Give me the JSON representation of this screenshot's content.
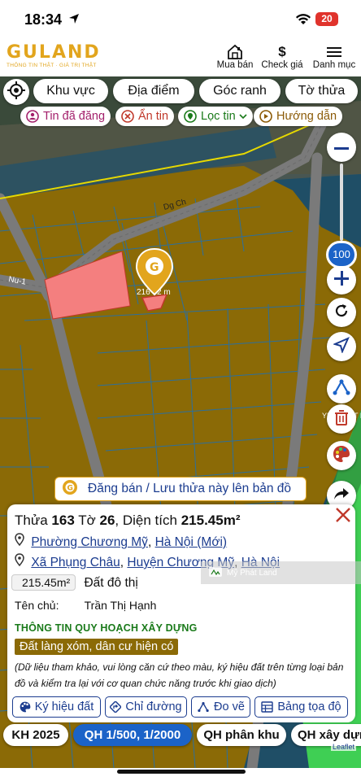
{
  "status_bar": {
    "time": "18:34",
    "battery": "20"
  },
  "header": {
    "logo_text": "GULAND",
    "logo_tagline": "THÔNG TIN THẬT · GIÁ TRỊ THẬT",
    "nav": [
      {
        "label": "Mua bán",
        "icon": "house-icon"
      },
      {
        "label": "Check giá",
        "icon": "dollar-icon"
      },
      {
        "label": "Danh mục",
        "icon": "menu-icon"
      }
    ]
  },
  "filters": {
    "tabs": [
      "Khu vực",
      "Địa điểm",
      "Góc ranh",
      "Tờ thửa"
    ],
    "chips": [
      {
        "label": "Tin đã đăng",
        "icon": "posted-icon"
      },
      {
        "label": "Ẩn tin",
        "icon": "hide-icon"
      },
      {
        "label": "Lọc tin",
        "icon": "filter-icon"
      },
      {
        "label": "Hướng dẫn",
        "icon": "play-icon"
      }
    ]
  },
  "map": {
    "zoom_level": "100",
    "road_label": "Dg Ch",
    "road_label_left": "Nu-1",
    "parcel_area_label": "216 ..2 m",
    "side_label": "YM S VIET N",
    "colors": {
      "land": "#8b6a06",
      "selected_parcel": "#f47f7f",
      "road": "#7a7a7a",
      "parcel_lines": "#2b6f9e",
      "green_zone": "#3fcf54"
    }
  },
  "banner": {
    "text": "Đăng bán / Lưu thửa này lên bản đồ"
  },
  "parcel": {
    "thua_label": "Thửa",
    "thua_no": "163",
    "to_label": "Tờ",
    "to_no": "26",
    "dientich_label": ", Diện tích",
    "area": "215.45m²",
    "new_address": {
      "ward": "Phường Chương Mỹ",
      "city": "Hà Nội (Mới)"
    },
    "old_address": {
      "commune": "Xã Phụng Châu",
      "district": "Huyện Chương Mỹ",
      "city": "Hà Nội"
    },
    "area_box": "215.45m²",
    "land_type": "Đất đô thị",
    "owner_label": "Tên chủ:",
    "owner_name": "Trần Thị Hạnh",
    "planning_title": "THÔNG TIN QUY HOẠCH XÂY DỰNG",
    "planning_tag": "Đất làng xóm, dân cư hiện có",
    "note": "(Dữ liệu tham khảo, vui lòng căn cứ theo màu, ký hiệu đất trên từng loại bản đồ và kiểm tra lại với cơ quan chức năng trước khi giao dịch)",
    "sep": ",",
    "sep2": ","
  },
  "actions": [
    {
      "label": "Ký hiệu đất",
      "icon": "palette-icon"
    },
    {
      "label": "Chỉ đường",
      "icon": "directions-icon"
    },
    {
      "label": "Đo vẽ",
      "icon": "measure-icon"
    },
    {
      "label": "Bảng tọa độ",
      "icon": "table-icon"
    }
  ],
  "layers": [
    {
      "label": "KH 2025",
      "active": false
    },
    {
      "label": "QH 1/500, 1/2000",
      "active": true
    },
    {
      "label": "QH phân khu",
      "active": false
    },
    {
      "label": "QH xây dựng",
      "active": false
    }
  ],
  "watermark": "Mỹ Phát Land",
  "attribution": "Leaflet"
}
